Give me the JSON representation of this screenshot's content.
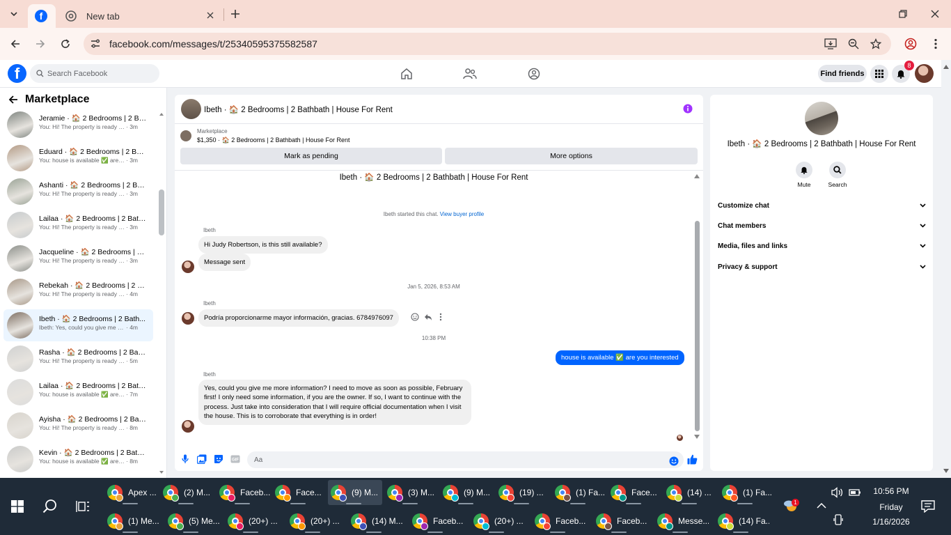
{
  "browser": {
    "active_tab_title": "",
    "inactive_tab_title": "New tab",
    "url": "facebook.com/messages/t/25340595375582587"
  },
  "fb": {
    "search_placeholder": "Search Facebook",
    "find_friends": "Find friends",
    "notif_count": "8"
  },
  "left": {
    "title": "Marketplace",
    "conversations": [
      {
        "name": "Jeramie · 🏠 2 Bedrooms | 2 Ba...",
        "preview": "You: Hi! The property is ready ✨...",
        "time": "· 3m",
        "color": "#7f8580"
      },
      {
        "name": "Eduard · 🏠 2 Bedrooms | 2 Bat...",
        "preview": "You: house is available ✅ are yo...",
        "time": "· 3m",
        "color": "#b39a84"
      },
      {
        "name": "Ashanti · 🏠 2 Bedrooms | 2 Ba...",
        "preview": "You: Hi! The property is ready ✨...",
        "time": "· 3m",
        "color": "#9aa396"
      },
      {
        "name": "Lailaa · 🏠 2 Bedrooms | 2 Bath...",
        "preview": "You: Hi! The property is ready ✨...",
        "time": "· 3m",
        "color": "#c7cbcd"
      },
      {
        "name": "Jacqueline · 🏠 2 Bedrooms | 2 ...",
        "preview": "You: Hi! The property is ready ✨...",
        "time": "· 3m",
        "color": "#8c8f8a"
      },
      {
        "name": "Rebekah · 🏠 2 Bedrooms | 2 B...",
        "preview": "You: Hi! The property is ready ✨...",
        "time": "· 4m",
        "color": "#a89888"
      },
      {
        "name": "Ibeth · 🏠 2 Bedrooms | 2 Bath...",
        "preview": "Ibeth: Yes, could you give me mor...",
        "time": "· 4m",
        "color": "#7d6e62"
      },
      {
        "name": "Rasha · 🏠 2 Bedrooms | 2 Bath...",
        "preview": "You: Hi! The property is ready ✨...",
        "time": "· 5m",
        "color": "#d0d1d1"
      },
      {
        "name": "Lailaa · 🏠 2 Bedrooms | 2 Bath...",
        "preview": "You: house is available ✅ are yo...",
        "time": "· 7m",
        "color": "#dcdcdc"
      },
      {
        "name": "Ayisha · 🏠 2 Bedrooms | 2 Bat...",
        "preview": "You: Hi! The property is ready ✨...",
        "time": "· 8m",
        "color": "#d8d4cd"
      },
      {
        "name": "Kevin · 🏠 2 Bedrooms | 2 Bath...",
        "preview": "You: house is available ✅ are yo...",
        "time": "· 8m",
        "color": "#c9cac9"
      }
    ]
  },
  "chat": {
    "header_title": "Ibeth · 🏠 2 Bedrooms | 2 Bathbath | House For Rent",
    "marketplace_label": "Marketplace",
    "listing": "$1,350 · 🏠 2 Bedrooms | 2 Bathbath | House For Rent",
    "mark_pending": "Mark as pending",
    "more_options": "More options",
    "body_title": "Ibeth · 🏠 2 Bedrooms | 2 Bathbath | House For Rent",
    "started_text": "Ibeth started this chat.",
    "view_profile": "View buyer profile",
    "sender": "Ibeth",
    "msg1": "Hi Judy Robertson, is this still available?",
    "msg2": "Message sent",
    "ts1": "Jan 5, 2026, 8:53 AM",
    "msg3": "Podría proporcionarme mayor información, gracias. 6784976097",
    "ts2": "10:38 PM",
    "msg_out": "house is available ✅ are you interested",
    "msg4": "Yes, could you give me more information? I need to move as soon as possible, February first! I only need some information, if you are the owner. If so, I want to continue with the process. Just take into consideration that I will require official documentation when I visit the house. This is to corroborate that everything is in order!",
    "composer_placeholder": "Aa"
  },
  "right": {
    "title": "Ibeth · 🏠 2 Bedrooms | 2 Bathbath | House For Rent",
    "mute": "Mute",
    "search": "Search",
    "sections": [
      "Customize chat",
      "Chat members",
      "Media, files and links",
      "Privacy & support"
    ]
  },
  "taskbar": {
    "row1": [
      "Apex ...",
      "(2) M...",
      "Faceb...",
      "Face...",
      "(9) M...",
      "(3) M...",
      "(9) M...",
      "(19) ...",
      "(1) Fa...",
      "Face...",
      "(14) ...",
      "(1) Fa..."
    ],
    "row2": [
      "(1) Me...",
      "(5) Me...",
      "(20+) ...",
      "(20+) ...",
      "(14) M...",
      "Faceb...",
      "(20+) ...",
      "Faceb...",
      "Faceb...",
      "Messe...",
      "(14) Fa..."
    ],
    "weather_badge": "1",
    "time": "10:56 PM",
    "day": "Friday",
    "date": "1/16/2026"
  }
}
